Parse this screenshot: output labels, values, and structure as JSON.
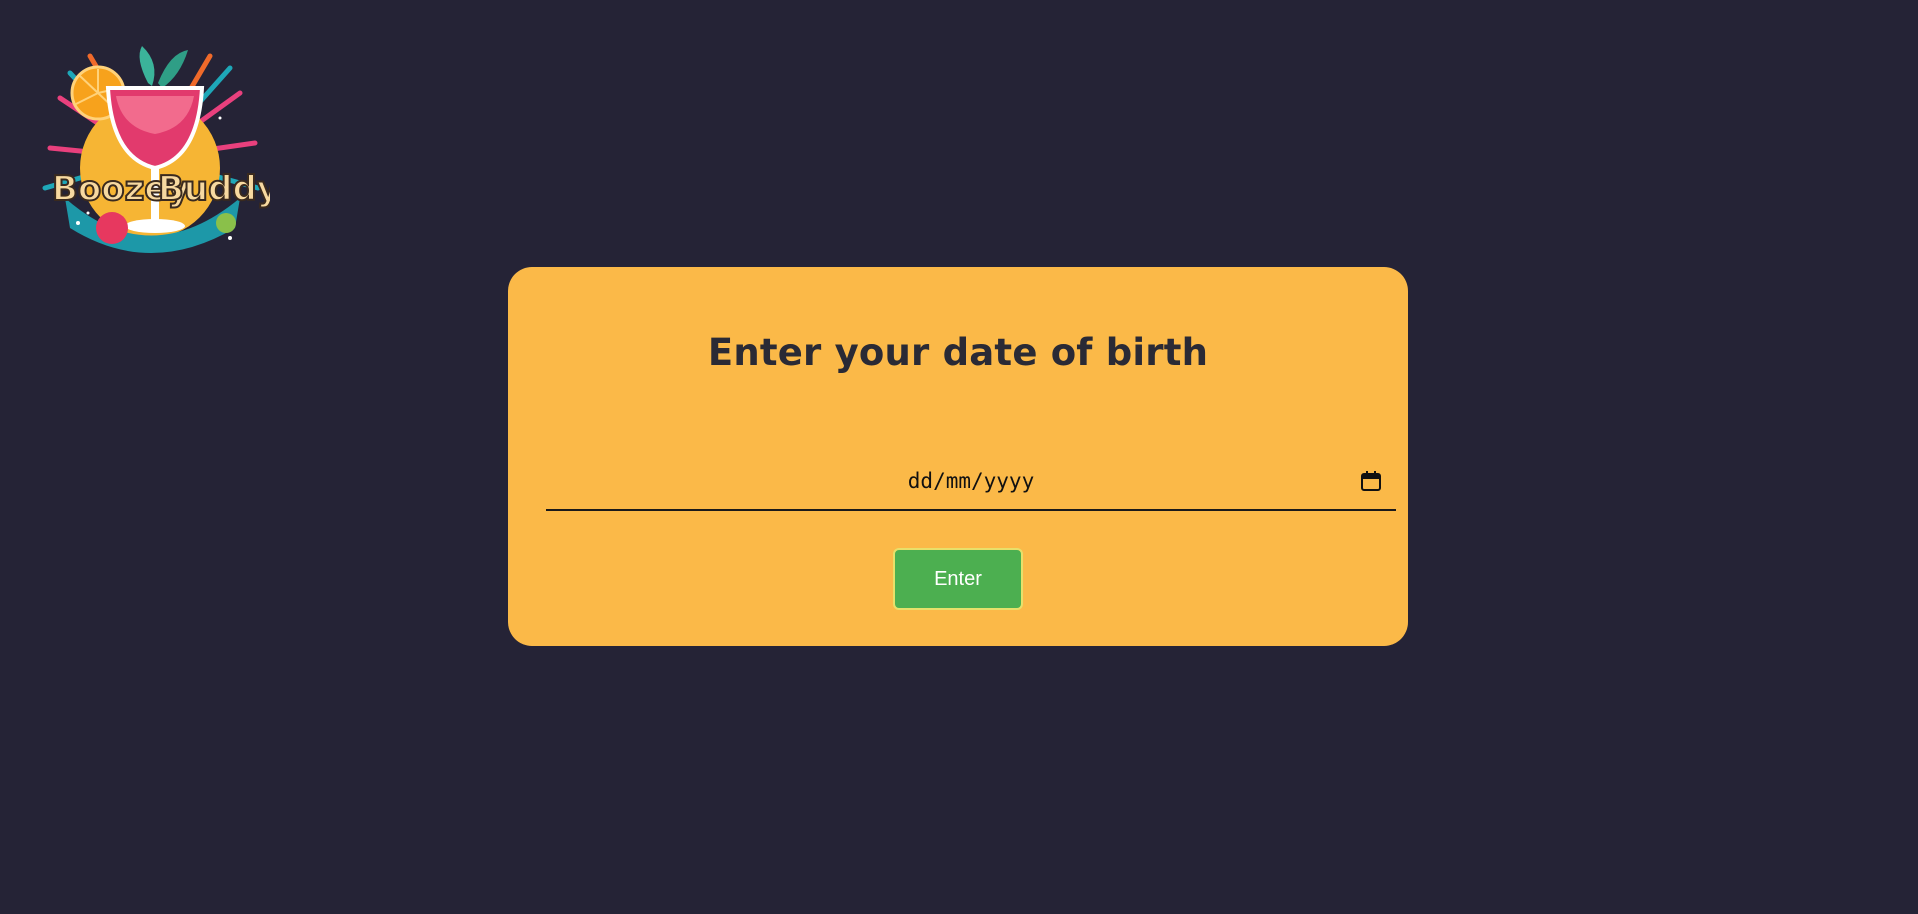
{
  "logo": {
    "text": "Boozey Buddy",
    "icon": "cocktail-logo"
  },
  "card": {
    "title": "Enter your date of birth",
    "date_input": {
      "placeholder": "dd/mm/yyyy",
      "value": "",
      "icon": "calendar-icon"
    },
    "enter_label": "Enter"
  },
  "colors": {
    "background": "#252336",
    "card": "#fbb948",
    "button": "#4caf50",
    "title": "#2a2a35"
  }
}
